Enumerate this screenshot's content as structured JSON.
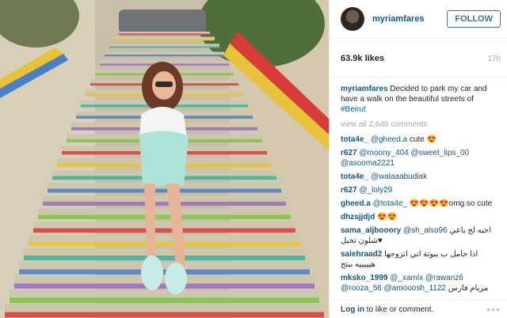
{
  "header": {
    "username": "myriamfares",
    "follow_label": "FOLLOW"
  },
  "meta": {
    "likes": "63.9k likes",
    "time": "17h"
  },
  "caption": {
    "username": "myriamfares",
    "text": "Decided to park my car and have a walk on the beautiful streets of",
    "hashtag": "#Beirut"
  },
  "view_all": "view all 2,646 comments",
  "comments": [
    {
      "user": "tota4e_",
      "mention": "@gheed.a",
      "text": "cute 😍"
    },
    {
      "user": "r627",
      "mention": "@moony_404 @sweet_lips_00 @asooma2221",
      "text": ""
    },
    {
      "user": "tota4e_",
      "mention": "@walaaabudiak",
      "text": ""
    },
    {
      "user": "r627",
      "mention": "@_loly29",
      "text": ""
    },
    {
      "user": "gheed.a",
      "mention": "@tota4e_",
      "text": "😍😍😍😍omg so cute"
    },
    {
      "user": "dhzsjjdjd",
      "mention": "",
      "text": "😍😍"
    },
    {
      "user": "sama_aljbooory",
      "mention": "@sh_also96",
      "text": "احبه لج باعي شلون تخبل♥"
    },
    {
      "user": "salehraad2",
      "mention": "",
      "text": "اذا حامل ب بنوتة اني اتزوجها هيييييه ببتج"
    },
    {
      "user": "mksko_1999",
      "mention": "@_xamlx @rawanz6 @rooza_56 @amooosh_1122",
      "text": "مريام فارس"
    }
  ],
  "footer": {
    "login_label": "Log in",
    "login_suffix": "to like or comment.",
    "more_icon": "more-dots-icon"
  },
  "photo": {
    "stair_colors": [
      "#d93a3a",
      "#e8c23a",
      "#3bb39a",
      "#4a7fc4",
      "#9b6bc0",
      "#7fc24a"
    ]
  }
}
